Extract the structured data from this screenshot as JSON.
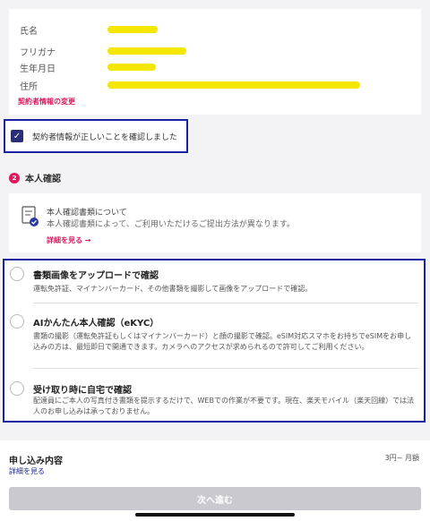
{
  "contract_info": {
    "rows": [
      {
        "label": "氏名"
      },
      {
        "label": "フリガナ"
      },
      {
        "label": "生年月日"
      },
      {
        "label": "住所"
      }
    ],
    "change_link": "契約者情報の変更"
  },
  "confirm": {
    "label": "契約者情報が正しいことを確認しました",
    "checked": true
  },
  "identity": {
    "step": "2",
    "title": "本人確認",
    "doc_title": "本人確認書類について",
    "doc_sub": "本人確認書類によって、ご利用いただけるご提出方法が異なります。",
    "detail_link": "詳細を見る →"
  },
  "options": [
    {
      "title": "書類画像をアップロードで確認",
      "desc": "運転免許証、マイナンバーカード、その他書類を撮影して画像をアップロードで確認。"
    },
    {
      "title": "AIかんたん本人確認（eKYC）",
      "desc": "書類の撮影（運転免許証もしくはマイナンバーカード）と顔の撮影で確認。eSIM対応スマホをお持ちでeSIMをお申し込みの方は、最短即日で開通できます。カメラへのアクセスが求められるので許可してご利用ください。"
    },
    {
      "title": "受け取り時に自宅で確認",
      "desc": "配達員にご本人の写真付き書類を提示するだけで、WEBでの作業が不要です。現在、楽天モバイル（楽天回線）では法人のお申し込みは承っておりません。"
    }
  ],
  "summary": {
    "title": "申し込み内容",
    "detail_link": "詳細を見る",
    "price": "3円~ 月額"
  },
  "next_button": "次へ進む",
  "colors": {
    "accent": "#d81b60",
    "highlight_border": "#1a22a0",
    "redaction": "#f5e600",
    "disabled_button": "#c9c9cf"
  }
}
